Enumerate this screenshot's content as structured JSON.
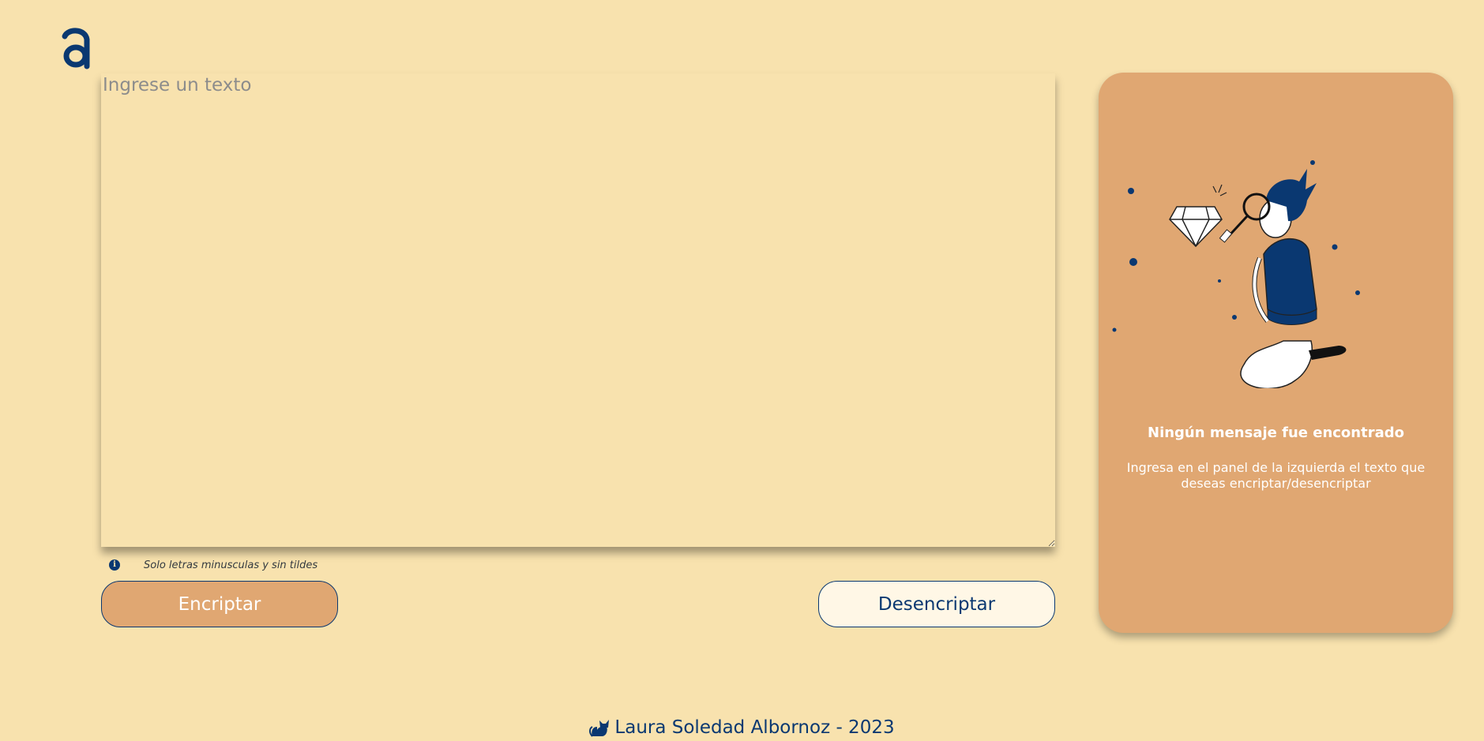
{
  "logo": {
    "icon": "alura-logo-icon"
  },
  "input": {
    "placeholder": "Ingrese un texto",
    "value": ""
  },
  "hint": {
    "icon": "info-icon",
    "symbol": "i",
    "text": "Solo letras minusculas y sin tildes"
  },
  "buttons": {
    "encrypt_label": "Encriptar",
    "decrypt_label": "Desencriptar"
  },
  "panel": {
    "title": "Ningún mensaje fue encontrado",
    "body": "Ingresa en el panel de la izquierda el texto que deseas encriptar/desencriptar"
  },
  "footer": {
    "icon": "cat-icon",
    "text": "Laura Soledad Albornoz - 2023"
  },
  "colors": {
    "background": "#f8e2ae",
    "accent": "#e0a772",
    "primary": "#0a3871",
    "secondary_button": "#fff7e6"
  }
}
